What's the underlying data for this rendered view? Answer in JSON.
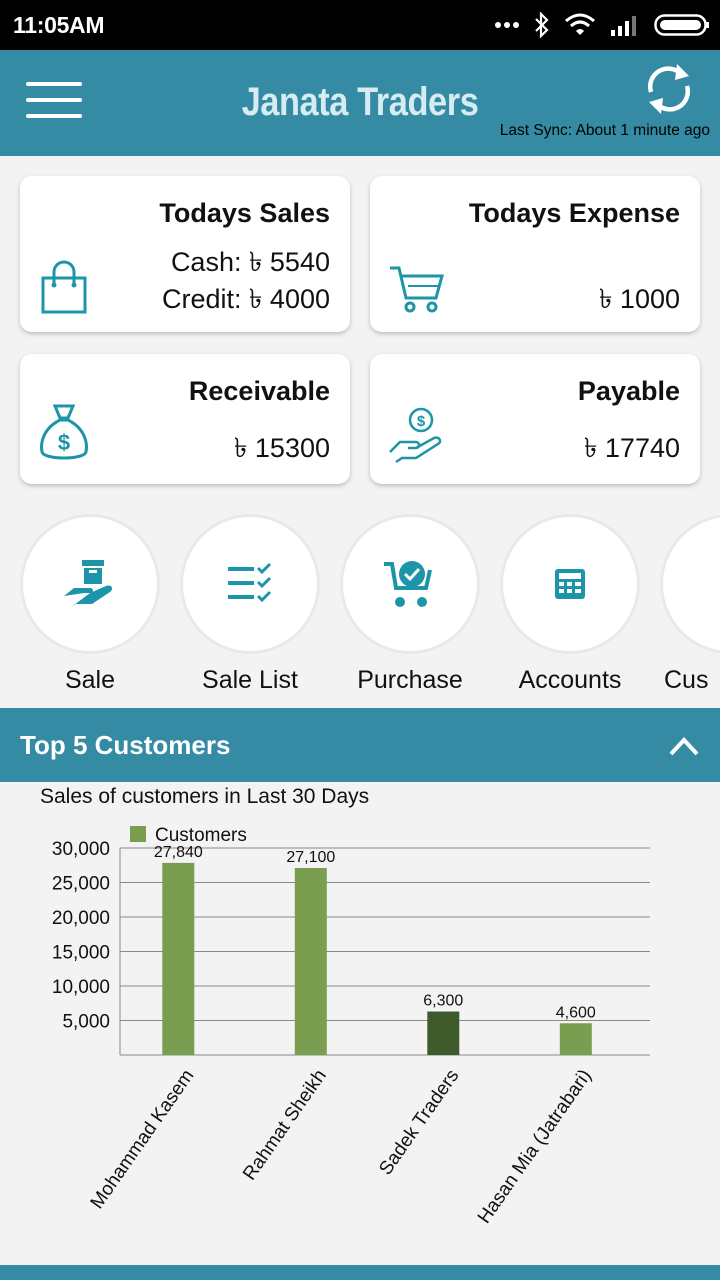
{
  "status_bar": {
    "time": "11:05AM"
  },
  "app_bar": {
    "title": "Janata Traders",
    "last_sync": "Last Sync: About 1 minute ago"
  },
  "cards": {
    "sales": {
      "title": "Todays Sales",
      "cash": "Cash: ৳ 5540",
      "credit": "Credit: ৳ 4000"
    },
    "expense": {
      "title": "Todays Expense",
      "value": "৳ 1000"
    },
    "receivable": {
      "title": "Receivable",
      "value": "৳ 15300"
    },
    "payable": {
      "title": "Payable",
      "value": "৳ 17740"
    }
  },
  "actions": [
    {
      "label": "Sale",
      "icon": "hand-box-icon"
    },
    {
      "label": "Sale List",
      "icon": "checklist-icon"
    },
    {
      "label": "Purchase",
      "icon": "cart-check-icon"
    },
    {
      "label": "Accounts",
      "icon": "calculator-icon"
    },
    {
      "label": "Cus",
      "icon": "customer-icon"
    }
  ],
  "section": {
    "title": "Top 5 Customers"
  },
  "chart_subtitle": "Sales of customers in Last 30 Days",
  "colors": {
    "primary": "#358ba3",
    "bar": "#7a9e4f",
    "bar_dark": "#3f5b2b",
    "icon": "#1c95a8"
  },
  "chart_data": {
    "type": "bar",
    "categories": [
      "Mohammad Kasem",
      "Rahmat Sheikh",
      "Sadek Traders",
      "Hasan Mia (Jatrabari)"
    ],
    "series": [
      {
        "name": "Customers",
        "values": [
          27840,
          27100,
          6300,
          4600
        ],
        "labels": [
          "27,840",
          "27,100",
          "6,300",
          "4,600"
        ]
      }
    ],
    "highlight_index": 2,
    "y_ticks": [
      "5,000",
      "10,000",
      "15,000",
      "20,000",
      "25,000",
      "30,000"
    ],
    "y_tick_values": [
      5000,
      10000,
      15000,
      20000,
      25000,
      30000
    ],
    "ylim": [
      0,
      30000
    ],
    "grid": true,
    "legend": "top-left"
  }
}
